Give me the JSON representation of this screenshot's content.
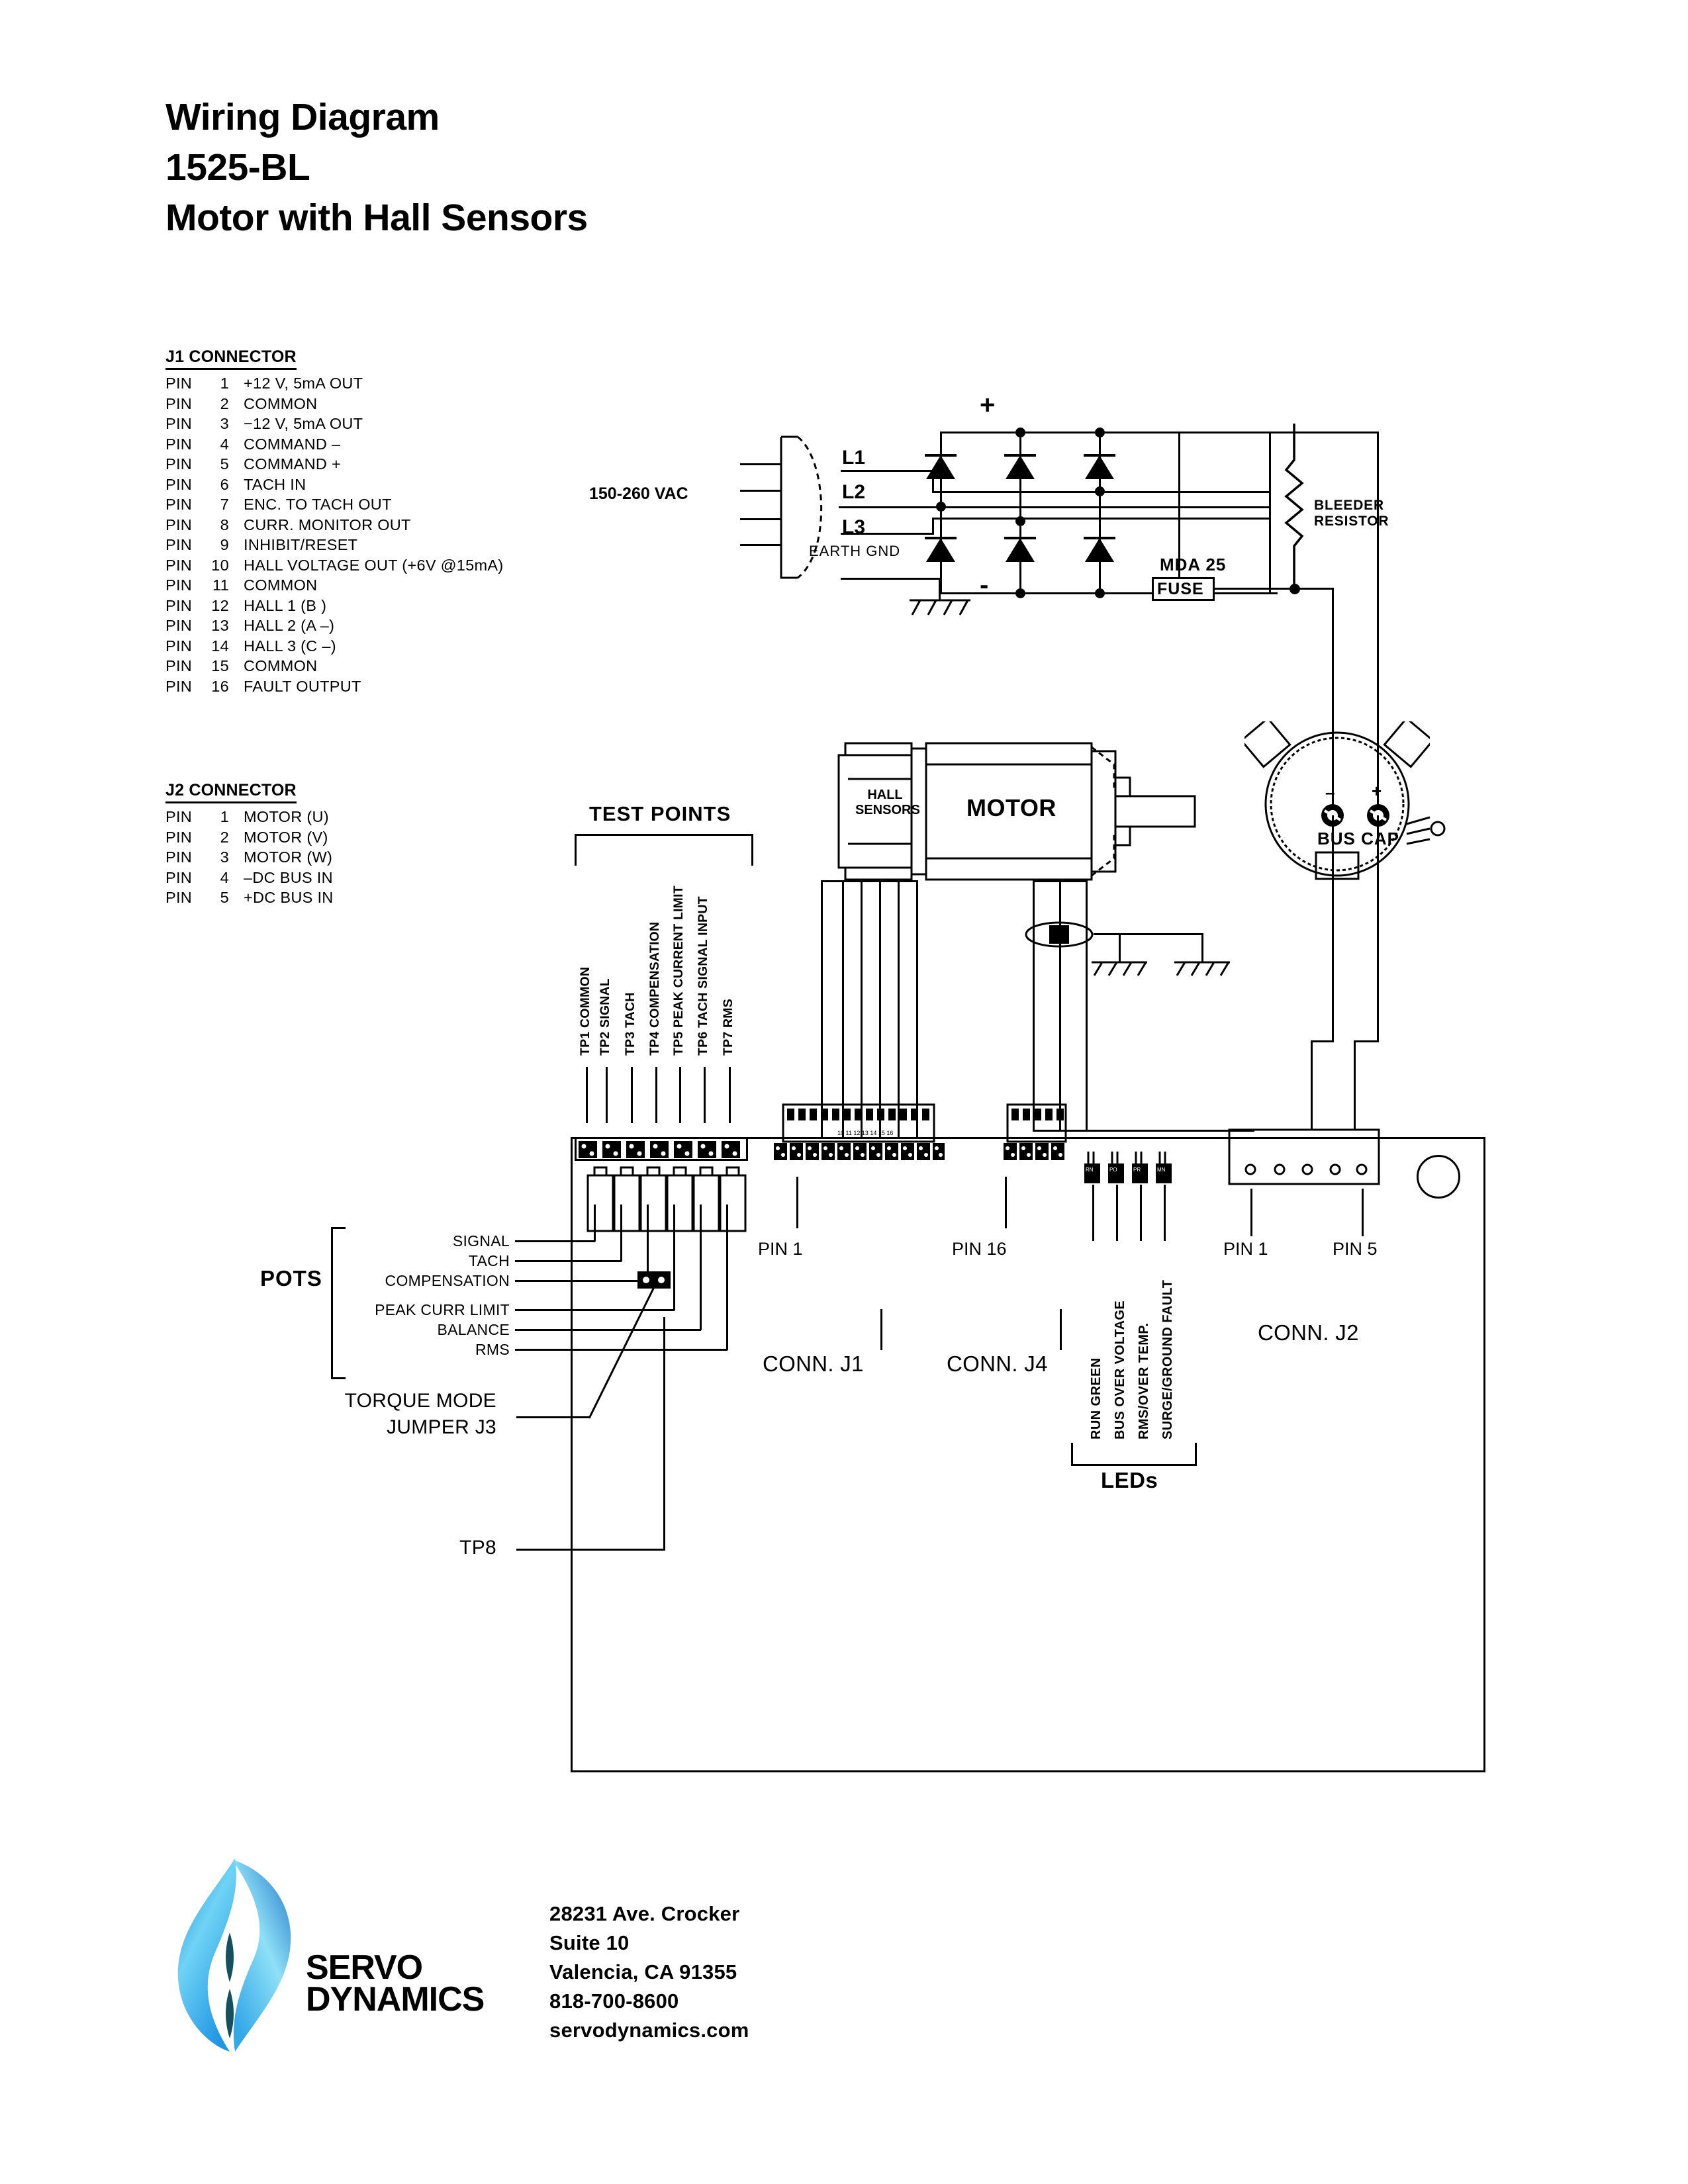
{
  "title": {
    "line1": "Wiring Diagram",
    "line2": "1525-BL",
    "line3": "Motor with Hall Sensors"
  },
  "j1_connector": {
    "heading": "J1 CONNECTOR",
    "pin_word": "PIN",
    "pins": [
      {
        "num": "1",
        "desc": "+12 V, 5mA OUT"
      },
      {
        "num": "2",
        "desc": "COMMON"
      },
      {
        "num": "3",
        "desc": "−12 V, 5mA OUT"
      },
      {
        "num": "4",
        "desc": "COMMAND –"
      },
      {
        "num": "5",
        "desc": "COMMAND +"
      },
      {
        "num": "6",
        "desc": "TACH IN"
      },
      {
        "num": "7",
        "desc": "ENC. TO TACH OUT"
      },
      {
        "num": "8",
        "desc": "CURR. MONITOR OUT"
      },
      {
        "num": "9",
        "desc": "INHIBIT/RESET"
      },
      {
        "num": "10",
        "desc": "HALL VOLTAGE OUT (+6V @15mA)"
      },
      {
        "num": "11",
        "desc": "COMMON"
      },
      {
        "num": "12",
        "desc": "HALL 1 (B  )"
      },
      {
        "num": "13",
        "desc": "HALL 2 (A –)"
      },
      {
        "num": "14",
        "desc": "HALL 3 (C –)"
      },
      {
        "num": "15",
        "desc": "COMMON"
      },
      {
        "num": "16",
        "desc": "FAULT OUTPUT"
      }
    ]
  },
  "j2_connector": {
    "heading": "J2 CONNECTOR",
    "pin_word": "PIN",
    "pins": [
      {
        "num": "1",
        "desc": "MOTOR (U)"
      },
      {
        "num": "2",
        "desc": "MOTOR (V)"
      },
      {
        "num": "3",
        "desc": "MOTOR (W)"
      },
      {
        "num": "4",
        "desc": "–DC BUS IN"
      },
      {
        "num": "5",
        "desc": "+DC BUS IN"
      }
    ]
  },
  "test_points": {
    "heading": "TEST POINTS",
    "items": [
      {
        "id": "TP1",
        "label": "COMMON"
      },
      {
        "id": "TP2",
        "label": "SIGNAL"
      },
      {
        "id": "TP3",
        "label": "TACH"
      },
      {
        "id": "TP4",
        "label": "COMPENSATION"
      },
      {
        "id": "TP5",
        "label": "PEAK CURRENT LIMIT"
      },
      {
        "id": "TP6",
        "label": "TACH SIGNAL INPUT"
      },
      {
        "id": "TP7",
        "label": "RMS"
      }
    ]
  },
  "pots": {
    "heading": "POTS",
    "items": [
      "SIGNAL",
      "TACH",
      "COMPENSATION",
      "PEAK CURR LIMIT",
      "BALANCE",
      "RMS"
    ]
  },
  "leds": {
    "heading": "LEDs",
    "items": [
      "RUN GREEN",
      "BUS OVER VOLTAGE",
      "RMS/OVER TEMP.",
      "SURGE/GROUND FAULT"
    ]
  },
  "power": {
    "ac_input": "150-260 VAC",
    "lines": [
      "L1",
      "L2",
      "L3"
    ],
    "earth": "EARTH  GND",
    "plus": "+",
    "minus": "-",
    "bleeder": [
      "BLEEDER",
      "RESISTOR"
    ],
    "fuse_part": "MDA 25",
    "fuse_label": "FUSE"
  },
  "motor": {
    "label": "MOTOR",
    "hall": [
      "HALL",
      "SENSORS"
    ]
  },
  "bus_cap": {
    "label": "BUS  CAP",
    "minus": "–",
    "plus": "+"
  },
  "board": {
    "torque_mode": [
      "TORQUE MODE",
      "JUMPER J3"
    ],
    "tp8": "TP8",
    "conn_j1_pin1": "PIN 1",
    "conn_j1_pin16": "PIN 16",
    "conn_j2_pin1": "PIN 1",
    "conn_j2_pin5": "PIN 5",
    "conn_j1": "CONN. J1",
    "conn_j4": "CONN. J4",
    "conn_j2": "CONN. J2"
  },
  "footer": {
    "logo_line1": "SERVO",
    "logo_line2": "DYNAMICS",
    "address": [
      "28231 Ave. Crocker",
      "Suite 10",
      "Valencia, CA 91355",
      "818-700-8600",
      "servodynamics.com"
    ]
  }
}
